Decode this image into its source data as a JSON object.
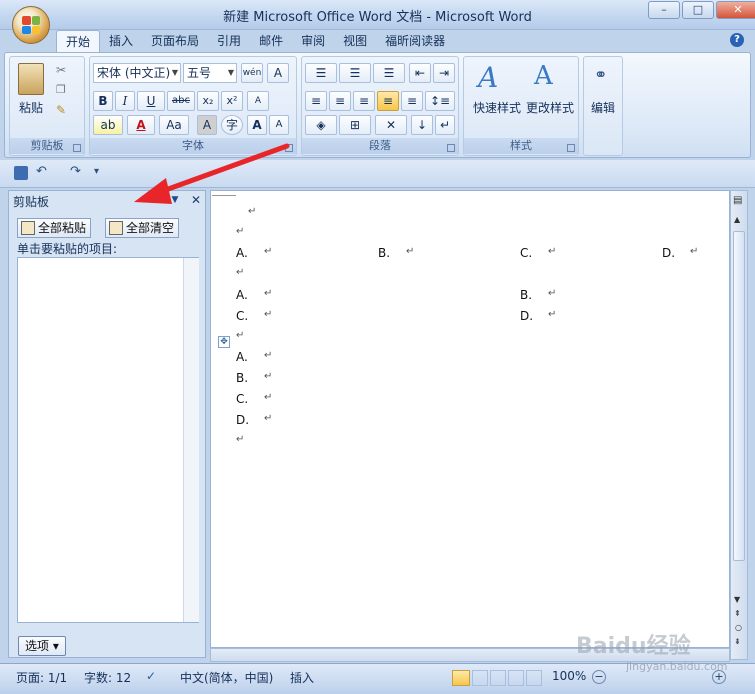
{
  "window": {
    "title": "新建 Microsoft Office Word 文档 - Microsoft Word",
    "minimize": "–",
    "restore": "□",
    "close": "✕"
  },
  "tabs": [
    "开始",
    "插入",
    "页面布局",
    "引用",
    "邮件",
    "审阅",
    "视图",
    "福昕阅读器"
  ],
  "ribbon": {
    "clipboard": {
      "paste": "粘贴",
      "label": "剪贴板"
    },
    "font": {
      "name": "宋体 (中文正)",
      "size": "五号",
      "label": "字体",
      "bold": "B",
      "italic": "I",
      "underline": "U",
      "strike": "abc",
      "sub": "x₂",
      "sup": "x²",
      "grow": "A",
      "shrink": "A",
      "aa": "Aa",
      "clear": "A",
      "wen": "wén",
      "charborder": "A"
    },
    "paragraph": {
      "label": "段落"
    },
    "styles": {
      "quick": "快速样式",
      "change": "更改样式",
      "label": "样式"
    },
    "editing": {
      "label": "编辑"
    }
  },
  "clipboard_pane": {
    "title": "剪贴板",
    "paste_all": "全部粘贴",
    "clear_all": "全部清空",
    "hint": "单击要粘贴的项目:",
    "options": "选项 ▾"
  },
  "document": {
    "mark": "↵",
    "row1": [
      "A.",
      "B.",
      "C.",
      "D."
    ],
    "table1": [
      [
        "A.",
        "B."
      ],
      [
        "C.",
        "D."
      ]
    ],
    "list": [
      "A.",
      "B.",
      "C.",
      "D."
    ]
  },
  "statusbar": {
    "page": "页面: 1/1",
    "words": "字数: 12",
    "lang": "中文(简体，中国)",
    "mode": "插入",
    "zoom": "100%"
  },
  "watermark": {
    "brand": "Baidu经验",
    "url": "jingyan.baidu.com"
  },
  "colors": {
    "arrow": "#e8262a",
    "ribbon_bg": "#dde9f7",
    "accent": "#2a62b5"
  }
}
